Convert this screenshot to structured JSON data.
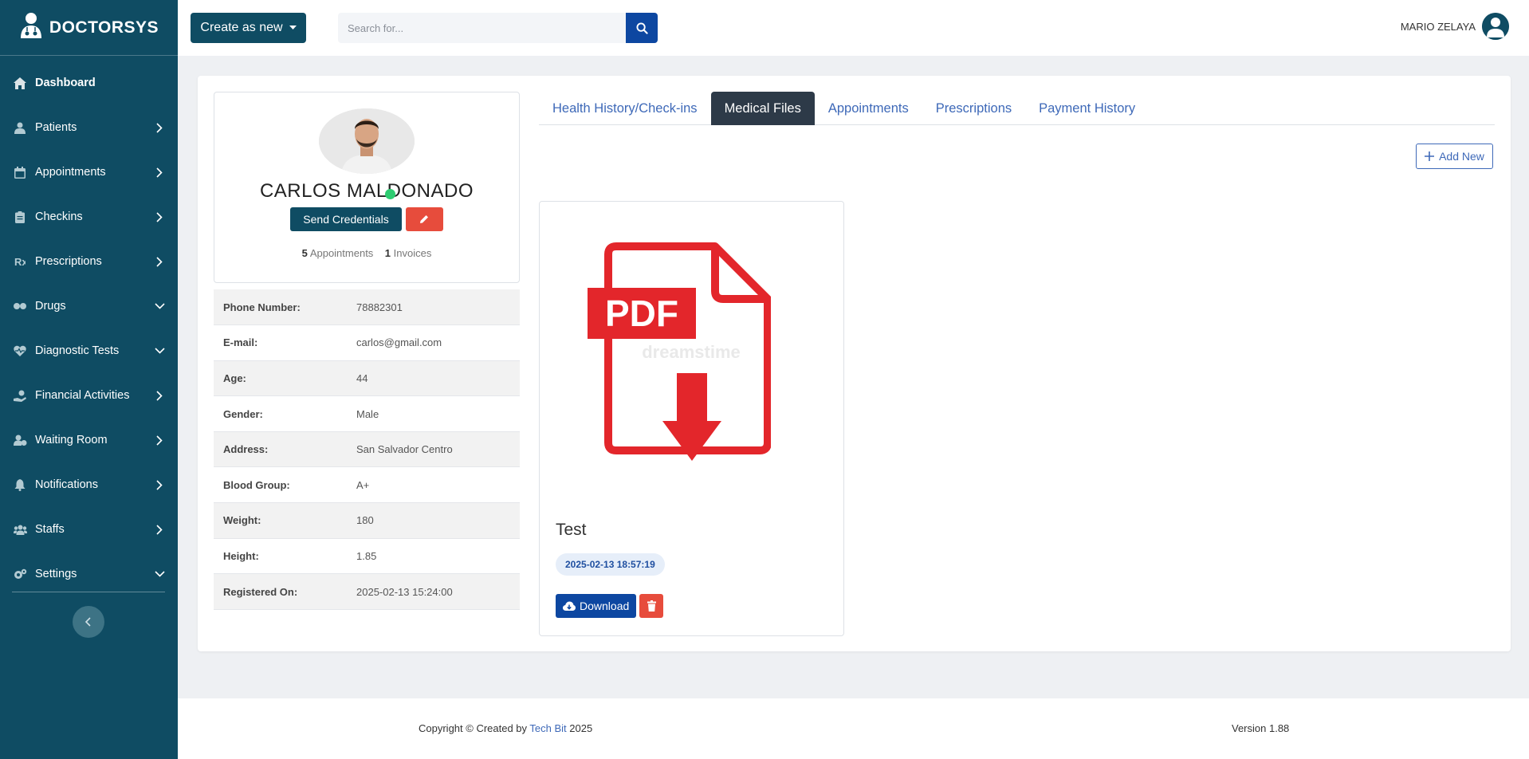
{
  "brand": {
    "name": "DOCTORSYS"
  },
  "sidebar": {
    "items": [
      {
        "label": "Dashboard",
        "icon": "home-icon",
        "chevron": "none",
        "active": true
      },
      {
        "label": "Patients",
        "icon": "user-icon",
        "chevron": "right"
      },
      {
        "label": "Appointments",
        "icon": "calendar-icon",
        "chevron": "right"
      },
      {
        "label": "Checkins",
        "icon": "clipboard-icon",
        "chevron": "right"
      },
      {
        "label": "Prescriptions",
        "icon": "prescription-icon",
        "chevron": "right"
      },
      {
        "label": "Drugs",
        "icon": "pills-icon",
        "chevron": "down"
      },
      {
        "label": "Diagnostic Tests",
        "icon": "heart-pulse-icon",
        "chevron": "down"
      },
      {
        "label": "Financial Activities",
        "icon": "hand-money-icon",
        "chevron": "right"
      },
      {
        "label": "Waiting Room",
        "icon": "users-clock-icon",
        "chevron": "right"
      },
      {
        "label": "Notifications",
        "icon": "bell-icon",
        "chevron": "right"
      },
      {
        "label": "Staffs",
        "icon": "users-icon",
        "chevron": "right"
      },
      {
        "label": "Settings",
        "icon": "gears-icon",
        "chevron": "down"
      }
    ]
  },
  "topbar": {
    "create_label": "Create as new",
    "search_placeholder": "Search for...",
    "user_name": "MARIO ZELAYA"
  },
  "patient": {
    "name": "CARLOS MALDONADO",
    "send_credentials_label": "Send Credentials",
    "appointments_count": "5",
    "appointments_label": "Appointments",
    "invoices_count": "1",
    "invoices_label": "Invoices",
    "details": [
      {
        "key": "Phone Number:",
        "value": "78882301"
      },
      {
        "key": "E-mail:",
        "value": "carlos@gmail.com"
      },
      {
        "key": "Age:",
        "value": "44"
      },
      {
        "key": "Gender:",
        "value": "Male"
      },
      {
        "key": "Address:",
        "value": "San Salvador Centro"
      },
      {
        "key": "Blood Group:",
        "value": "A+"
      },
      {
        "key": "Weight:",
        "value": "180"
      },
      {
        "key": "Height:",
        "value": "1.85"
      },
      {
        "key": "Registered On:",
        "value": "2025-02-13 15:24:00"
      }
    ]
  },
  "tabs": [
    {
      "label": "Health History/Check-ins",
      "active": false
    },
    {
      "label": "Medical Files",
      "active": true
    },
    {
      "label": "Appointments",
      "active": false
    },
    {
      "label": "Prescriptions",
      "active": false
    },
    {
      "label": "Payment History",
      "active": false
    }
  ],
  "add_new_label": "Add New",
  "file": {
    "badge": "PDF",
    "watermark": "dreamstime",
    "title": "Test",
    "date": "2025-02-13 18:57:19",
    "download_label": "Download"
  },
  "footer": {
    "copyright_prefix": "Copyright © Created by",
    "author": "Tech Bit",
    "year": "2025",
    "version": "Version 1.88"
  },
  "colors": {
    "sidebar": "#0f4c63",
    "primary": "#0d47a1",
    "danger": "#e74c3c",
    "tab_active": "#2d3a48",
    "link": "#3e69b8"
  }
}
